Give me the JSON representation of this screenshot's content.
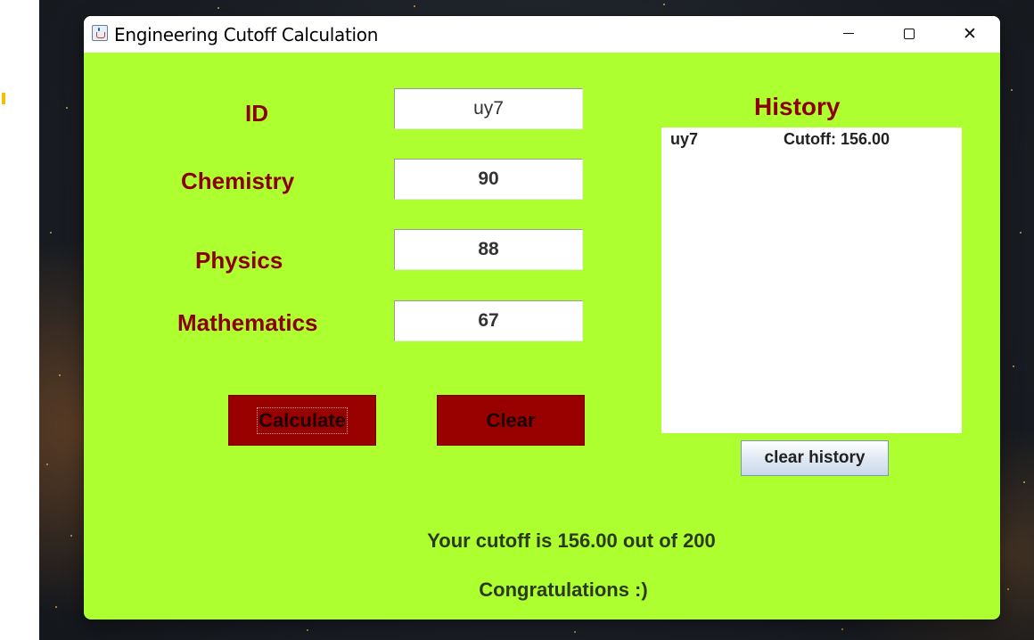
{
  "window": {
    "title": "Engineering Cutoff Calculation",
    "background_color": "#adff2f",
    "controls": {
      "minimize_icon": "minimize-icon",
      "maximize_icon": "maximize-icon",
      "close_icon": "close-icon"
    }
  },
  "form": {
    "id_label": "ID",
    "id_value": "uy7",
    "chemistry_label": "Chemistry",
    "chemistry_value": "90",
    "physics_label": "Physics",
    "physics_value": "88",
    "mathematics_label": "Mathematics",
    "mathematics_value": "67",
    "label_color": "#8b0000"
  },
  "buttons": {
    "calculate_label": "Calculate",
    "clear_label": "Clear",
    "button_color": "#990000"
  },
  "history": {
    "title": "History",
    "entries": [
      {
        "id": "uy7",
        "cutoff": "Cutoff: 156.00"
      }
    ],
    "clear_label": "clear history"
  },
  "result": {
    "cutoff_text": "Your cutoff is 156.00 out of 200",
    "message": "Congratulations :)"
  }
}
